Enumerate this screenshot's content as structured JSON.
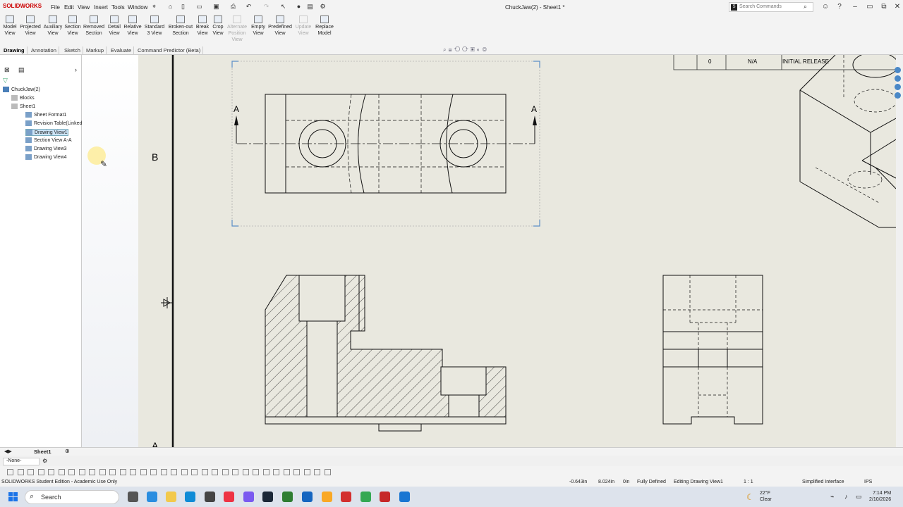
{
  "app": {
    "logo": "SOLIDWORKS",
    "document_title": "ChuckJaw(2) - Sheet1 *",
    "search_placeholder": "Search Commands"
  },
  "menu": [
    "File",
    "Edit",
    "View",
    "Insert",
    "Tools",
    "Window"
  ],
  "toolbar": [
    {
      "label1": "Model",
      "label2": "View",
      "disabled": false
    },
    {
      "label1": "Projected",
      "label2": "View",
      "disabled": false
    },
    {
      "label1": "Auxiliary",
      "label2": "View",
      "disabled": false
    },
    {
      "label1": "Section",
      "label2": "View",
      "disabled": false
    },
    {
      "label1": "Removed",
      "label2": "Section",
      "disabled": false
    },
    {
      "label1": "Detail",
      "label2": "View",
      "disabled": false
    },
    {
      "label1": "Relative",
      "label2": "View",
      "disabled": false
    },
    {
      "label1": "Standard",
      "label2": "3 View",
      "disabled": false
    },
    {
      "label1": "Broken-out",
      "label2": "Section",
      "disabled": false
    },
    {
      "label1": "Break",
      "label2": "View",
      "disabled": false
    },
    {
      "label1": "Crop",
      "label2": "View",
      "disabled": false
    },
    {
      "label1": "Alternate",
      "label2": "Position View",
      "disabled": true
    },
    {
      "label1": "Empty",
      "label2": "View",
      "disabled": false
    },
    {
      "label1": "Predefined",
      "label2": "View",
      "disabled": false
    },
    {
      "label1": "Update",
      "label2": "View",
      "disabled": true
    },
    {
      "label1": "Replace",
      "label2": "Model",
      "disabled": false
    }
  ],
  "tabs": [
    "Drawing",
    "Annotation",
    "Sketch",
    "Markup",
    "Evaluate",
    "Command Predictor (Beta)"
  ],
  "tree": [
    {
      "label": "ChuckJaw(2)",
      "level": 0,
      "selected": false
    },
    {
      "label": "Blocks",
      "level": 1,
      "selected": false
    },
    {
      "label": "Sheet1",
      "level": 1,
      "selected": false
    },
    {
      "label": "Sheet Format1",
      "level": 2,
      "selected": false
    },
    {
      "label": "Revision Table(Linked)1",
      "level": 2,
      "selected": false
    },
    {
      "label": "Drawing View1",
      "level": 2,
      "selected": true
    },
    {
      "label": "Section View A-A",
      "level": 2,
      "selected": false
    },
    {
      "label": "Drawing View3",
      "level": 2,
      "selected": false
    },
    {
      "label": "Drawing View4",
      "level": 2,
      "selected": false
    }
  ],
  "drawing": {
    "revision_row": {
      "rev": "0",
      "zone": "N/A",
      "description": "INITIAL RELEASE"
    },
    "section_letter": "A",
    "zone_label_b": "B",
    "zone_label_a": "A"
  },
  "sheet_tab": "Sheet1",
  "layer": "-None-",
  "status": {
    "edition": "SOLIDWORKS Student Edition - Academic Use Only",
    "x": "-0.643in",
    "y": "8.024in",
    "z": "0in",
    "state": "Fully Defined",
    "editing": "Editing Drawing View1",
    "scale": "1 : 1",
    "interface": "Simplified Interface",
    "units": "IPS"
  },
  "taskbar": {
    "search": "Search",
    "temp": "22°F",
    "condition": "Clear",
    "time": "7:14 PM",
    "date": "2/10/2026"
  }
}
